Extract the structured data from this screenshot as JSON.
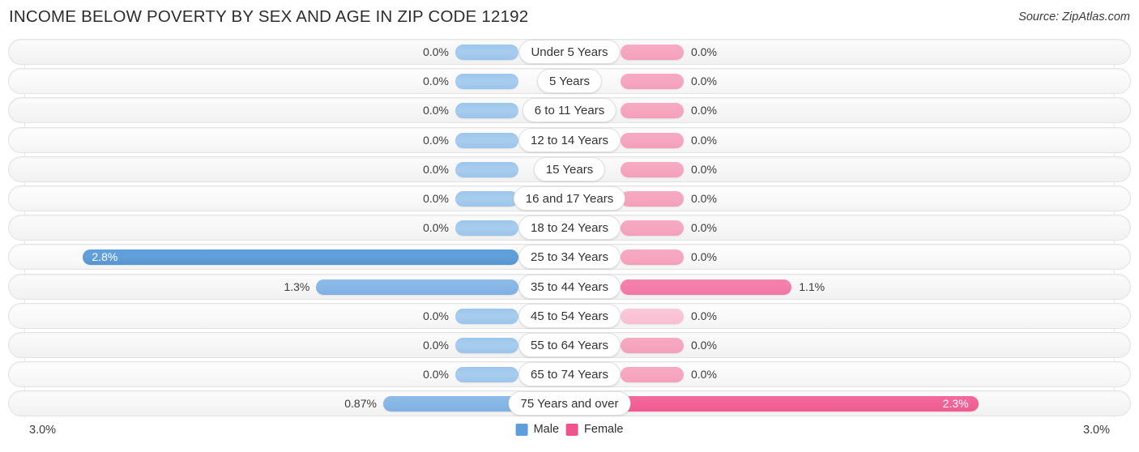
{
  "header": {
    "title": "INCOME BELOW POVERTY BY SEX AND AGE IN ZIP CODE 12192",
    "source": "Source: ZipAtlas.com"
  },
  "axis": {
    "left_max_label": "3.0%",
    "right_max_label": "3.0%"
  },
  "legend": {
    "male_label": "Male",
    "female_label": "Female",
    "male_color": "#5d9fdd",
    "female_color": "#f0548c"
  },
  "chart_data": {
    "type": "bar",
    "title": "INCOME BELOW POVERTY BY SEX AND AGE IN ZIP CODE 12192",
    "subtitle": "Source: ZipAtlas.com",
    "orientation": "horizontal-diverging",
    "xlabel": "",
    "ylabel": "",
    "xlim": [
      3.0,
      3.0
    ],
    "grid": true,
    "legend_position": "bottom-center",
    "categories": [
      "Under 5 Years",
      "5 Years",
      "6 to 11 Years",
      "12 to 14 Years",
      "15 Years",
      "16 and 17 Years",
      "18 to 24 Years",
      "25 to 34 Years",
      "35 to 44 Years",
      "45 to 54 Years",
      "55 to 64 Years",
      "65 to 74 Years",
      "75 Years and over"
    ],
    "series": [
      {
        "name": "Male",
        "values": [
          0.0,
          0.0,
          0.0,
          0.0,
          0.0,
          0.0,
          0.0,
          2.8,
          1.3,
          0.0,
          0.0,
          0.0,
          0.87
        ]
      },
      {
        "name": "Female",
        "values": [
          0.0,
          0.0,
          0.0,
          0.0,
          0.0,
          0.0,
          0.0,
          0.0,
          1.1,
          0.0,
          0.0,
          0.0,
          2.3
        ]
      }
    ]
  },
  "rows": [
    {
      "label": "Under 5 Years",
      "male_value": "0.0%",
      "female_value": "0.0%"
    },
    {
      "label": "5 Years",
      "male_value": "0.0%",
      "female_value": "0.0%"
    },
    {
      "label": "6 to 11 Years",
      "male_value": "0.0%",
      "female_value": "0.0%"
    },
    {
      "label": "12 to 14 Years",
      "male_value": "0.0%",
      "female_value": "0.0%"
    },
    {
      "label": "15 Years",
      "male_value": "0.0%",
      "female_value": "0.0%"
    },
    {
      "label": "16 and 17 Years",
      "male_value": "0.0%",
      "female_value": "0.0%"
    },
    {
      "label": "18 to 24 Years",
      "male_value": "0.0%",
      "female_value": "0.0%"
    },
    {
      "label": "25 to 34 Years",
      "male_value": "2.8%",
      "female_value": "0.0%"
    },
    {
      "label": "35 to 44 Years",
      "male_value": "1.3%",
      "female_value": "1.1%"
    },
    {
      "label": "45 to 54 Years",
      "male_value": "0.0%",
      "female_value": "0.0%"
    },
    {
      "label": "55 to 64 Years",
      "male_value": "0.0%",
      "female_value": "0.0%"
    },
    {
      "label": "65 to 74 Years",
      "male_value": "0.0%",
      "female_value": "0.0%"
    },
    {
      "label": "75 Years and over",
      "male_value": "0.87%",
      "female_value": "2.3%"
    }
  ]
}
